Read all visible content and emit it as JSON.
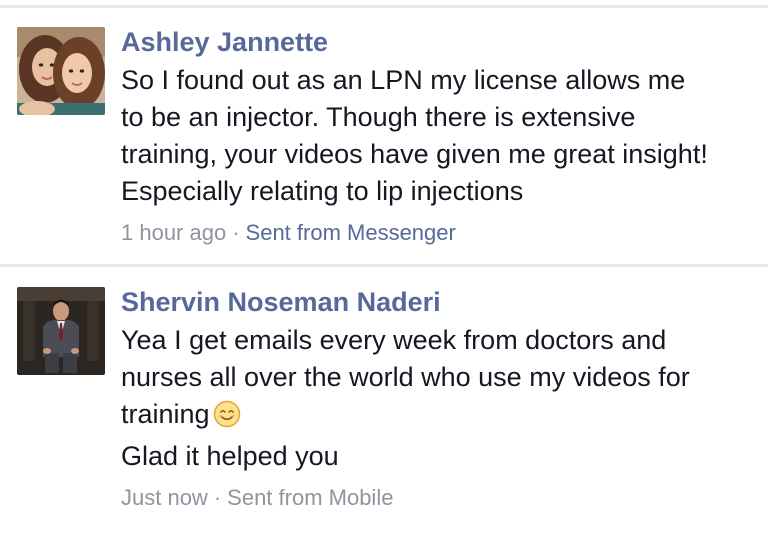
{
  "messages": [
    {
      "sender": "Ashley Jannette",
      "lines": [
        "So I found out as an LPN my license allows me",
        "to be an injector. Though there is extensive",
        "training, your videos have given me great insight!",
        "Especially relating to lip injections"
      ],
      "time": "1 hour ago",
      "separator": "·",
      "source": "Sent from Messenger",
      "avatar_icon": "two-women-photo-avatar"
    },
    {
      "sender": "Shervin Noseman Naderi",
      "lines": [
        "Yea I get emails every week from doctors and",
        "nurses all over the world who use my videos for",
        "training",
        "Glad it helped you"
      ],
      "emoji_after_line": 2,
      "emoji_icon": "smiling-face-emoji",
      "time": "Just now",
      "separator": "·",
      "source": "Sent from Mobile",
      "avatar_icon": "man-in-suit-photo-avatar"
    }
  ],
  "colors": {
    "sender_name": "#56699a",
    "body_text": "#141823",
    "meta_text": "#8f949e",
    "divider": "#e9eaed"
  }
}
